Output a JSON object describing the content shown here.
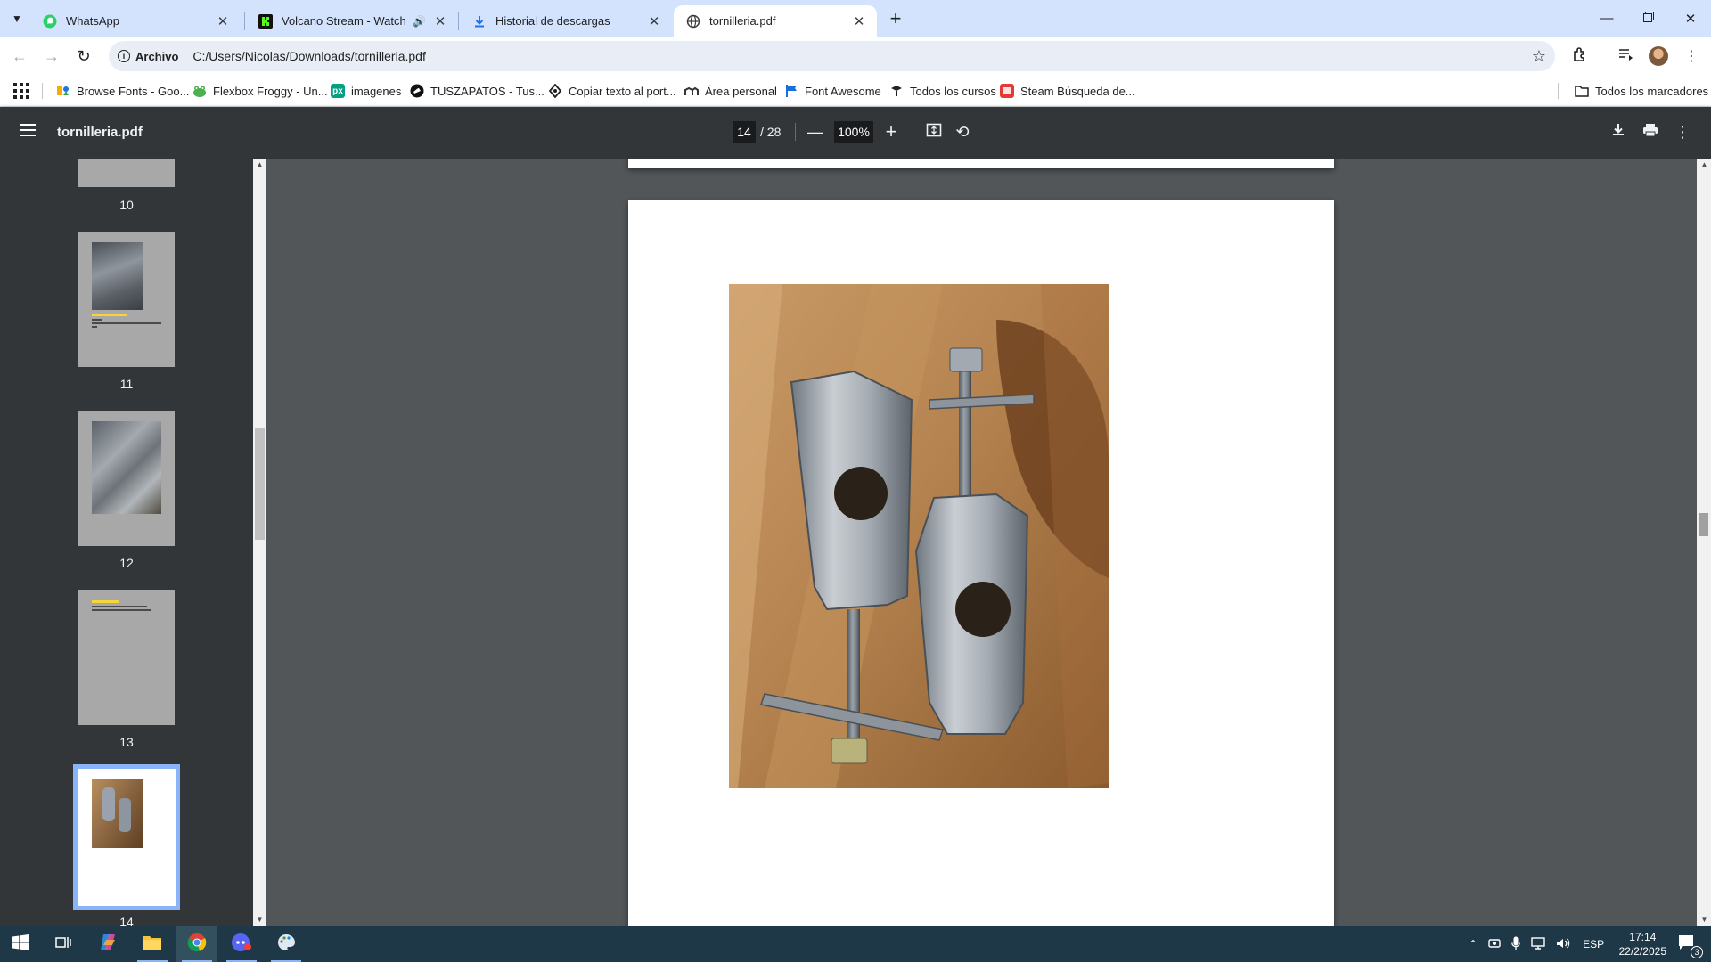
{
  "tabs": [
    {
      "title": "WhatsApp",
      "icon": "whatsapp-icon",
      "color": "#25d366"
    },
    {
      "title": "Volcano Stream - Watch Liv",
      "icon": "kick-icon",
      "color": "#53fc18",
      "audio": true
    },
    {
      "title": "Historial de descargas",
      "icon": "download-icon",
      "color": "#1a73e8"
    },
    {
      "title": "tornilleria.pdf",
      "icon": "globe-icon",
      "active": true
    }
  ],
  "address": {
    "chip_label": "Archivo",
    "url": "C:/Users/Nicolas/Downloads/tornilleria.pdf"
  },
  "bookmarks": [
    {
      "label": "Browse Fonts - Goo...",
      "icon": "google-fonts-icon"
    },
    {
      "label": "Flexbox Froggy - Un...",
      "icon": "frog-icon"
    },
    {
      "label": "imagenes",
      "icon": "pexels-icon",
      "badge": "px"
    },
    {
      "label": "TUSZAPATOS - Tus...",
      "icon": "tuszapatos-icon"
    },
    {
      "label": "Copiar texto al port...",
      "icon": "copy-site-icon"
    },
    {
      "label": "Área personal",
      "icon": "moodle-icon"
    },
    {
      "label": "Font Awesome",
      "icon": "font-awesome-icon"
    },
    {
      "label": "Todos los cursos",
      "icon": "courses-icon"
    },
    {
      "label": "Steam Búsqueda de...",
      "icon": "steam-icon"
    }
  ],
  "all_bookmarks_label": "Todos los marcadores",
  "pdf": {
    "filename": "tornilleria.pdf",
    "current_page": "14",
    "total_pages": "/ 28",
    "zoom": "100%"
  },
  "thumbnails": [
    {
      "number": "10"
    },
    {
      "number": "11"
    },
    {
      "number": "12"
    },
    {
      "number": "13"
    },
    {
      "number": "14",
      "selected": true
    }
  ],
  "taskbar": {
    "language": "ESP",
    "time": "17:14",
    "date": "22/2/2025",
    "notifications": "3"
  },
  "colors": {
    "tabstrip": "#d3e3fd",
    "pdf_toolbar": "#323639",
    "viewer_bg": "#525659",
    "selection": "#8ab4f8",
    "taskbar": "#1f3848"
  }
}
